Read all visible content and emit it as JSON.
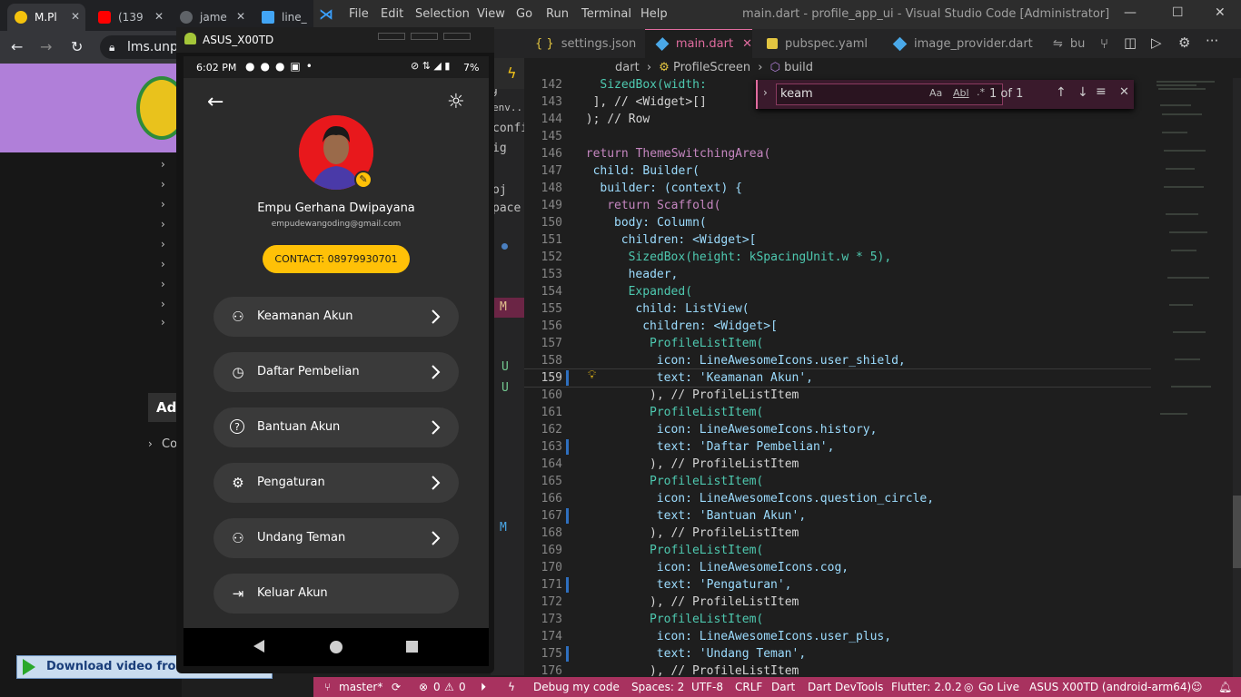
{
  "chrome": {
    "tabs": [
      {
        "title": "M.Pl",
        "favicon_color": "#f4c20d"
      },
      {
        "title": "(139",
        "favicon_color": "#ff0000"
      },
      {
        "title": "jame",
        "favicon_color": "#5f6368"
      },
      {
        "title": "line_",
        "favicon_color": "#42a5f5"
      }
    ],
    "url": "lms.unpa",
    "sidebar_label": "Adı",
    "sidebar_item": "Co",
    "download_banner": "Download video from t"
  },
  "vscode": {
    "menu": [
      "File",
      "Edit",
      "Selection",
      "View",
      "Go",
      "Run",
      "Terminal",
      "Help"
    ],
    "window_title": "main.dart - profile_app_ui - Visual Studio Code [Administrator]",
    "tabs": [
      {
        "label": "settings.json",
        "icon": "{ }"
      },
      {
        "label": "main.dart",
        "icon": "dart-icon"
      },
      {
        "label": "pubspec.yaml",
        "icon": "yaml-icon"
      },
      {
        "label": "image_provider.dart",
        "icon": "dart-icon"
      },
      {
        "label": "bu",
        "icon": "diff-icon"
      }
    ],
    "breadcrumb": {
      "file": "dart",
      "class": "ProfileScreen",
      "method": "build"
    },
    "find": {
      "query": "keam",
      "result": "1 of 1",
      "opt_case": "Aa",
      "opt_word": "Abl",
      "opt_regex": ".*"
    },
    "sidebar_fragments": [
      "g",
      "env...",
      "config",
      "ig",
      "oj",
      "pace"
    ],
    "sidebar_status_letters": [
      "M",
      "U",
      "U",
      "M"
    ],
    "code_lines": [
      {
        "n": "142",
        "text": "SizedBox(width:"
      },
      {
        "n": "143",
        "text": "], // <Widget>[]"
      },
      {
        "n": "144",
        "text": "); // Row"
      },
      {
        "n": "145",
        "text": ""
      },
      {
        "n": "146",
        "text": "return ThemeSwitchingArea("
      },
      {
        "n": "147",
        "text": "child: Builder("
      },
      {
        "n": "148",
        "text": "builder: (context) {"
      },
      {
        "n": "149",
        "text": "return Scaffold("
      },
      {
        "n": "150",
        "text": "body: Column("
      },
      {
        "n": "151",
        "text": "children: <Widget>["
      },
      {
        "n": "152",
        "text": "SizedBox(height: kSpacingUnit.w * 5),"
      },
      {
        "n": "153",
        "text": "header,"
      },
      {
        "n": "154",
        "text": "Expanded("
      },
      {
        "n": "155",
        "text": "child: ListView("
      },
      {
        "n": "156",
        "text": "children: <Widget>["
      },
      {
        "n": "157",
        "text": "ProfileListItem("
      },
      {
        "n": "158",
        "text": "icon: LineAwesomeIcons.user_shield,"
      },
      {
        "n": "159",
        "text": "text: 'Keamanan Akun',"
      },
      {
        "n": "160",
        "text": "), // ProfileListItem"
      },
      {
        "n": "161",
        "text": "ProfileListItem("
      },
      {
        "n": "162",
        "text": "icon: LineAwesomeIcons.history,"
      },
      {
        "n": "163",
        "text": "text: 'Daftar Pembelian',"
      },
      {
        "n": "164",
        "text": "), // ProfileListItem"
      },
      {
        "n": "165",
        "text": "ProfileListItem("
      },
      {
        "n": "166",
        "text": "icon: LineAwesomeIcons.question_circle,"
      },
      {
        "n": "167",
        "text": "text: 'Bantuan Akun',"
      },
      {
        "n": "168",
        "text": "), // ProfileListItem"
      },
      {
        "n": "169",
        "text": "ProfileListItem("
      },
      {
        "n": "170",
        "text": "icon: LineAwesomeIcons.cog,"
      },
      {
        "n": "171",
        "text": "text: 'Pengaturan',"
      },
      {
        "n": "172",
        "text": "), // ProfileListItem"
      },
      {
        "n": "173",
        "text": "ProfileListItem("
      },
      {
        "n": "174",
        "text": "icon: LineAwesomeIcons.user_plus,"
      },
      {
        "n": "175",
        "text": "text: 'Undang Teman',"
      },
      {
        "n": "176",
        "text": "), // ProfileListItem"
      }
    ],
    "status": {
      "branch": "master*",
      "errors": "0",
      "warnings": "0",
      "debug": "Debug my code",
      "spaces": "Spaces: 2",
      "encoding": "UTF-8",
      "eol": "CRLF",
      "language": "Dart",
      "devtools": "Dart DevTools",
      "flutter": "Flutter: 2.0.2",
      "golive": "Go Live",
      "device": "ASUS X00TD (android-arm64)"
    },
    "colors": {
      "accent": "#e06c9f",
      "status_bar": "#a8325f"
    }
  },
  "emulator": {
    "title": "ASUS_X00TD",
    "status_time": "6:02 PM",
    "battery": "7%",
    "profile": {
      "name": "Empu Gerhana Dwipayana",
      "email": "empudewangoding@gmail.com",
      "contact": "CONTACT: 08979930701"
    },
    "menu": [
      {
        "label": "Keamanan Akun",
        "icon": "user-shield-icon"
      },
      {
        "label": "Daftar Pembelian",
        "icon": "history-icon"
      },
      {
        "label": "Bantuan Akun",
        "icon": "question-circle-icon"
      },
      {
        "label": "Pengaturan",
        "icon": "cog-icon"
      },
      {
        "label": "Undang Teman",
        "icon": "user-plus-icon"
      },
      {
        "label": "Keluar Akun",
        "icon": "sign-out-icon"
      }
    ],
    "colors": {
      "accent": "#ffc107",
      "avatar_bg": "#e8181c"
    }
  }
}
